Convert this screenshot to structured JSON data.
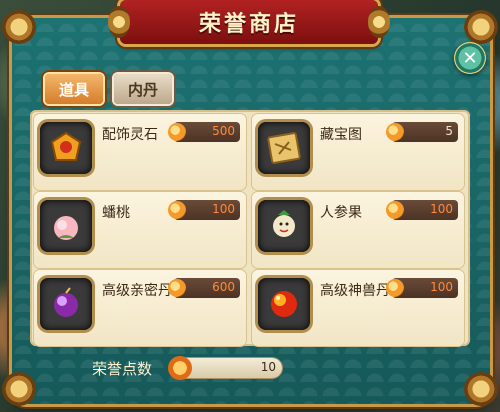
{
  "shop": {
    "title": "荣誉商店",
    "close_icon": "✕",
    "tabs": [
      {
        "label": "道具",
        "active": true
      },
      {
        "label": "内丹",
        "active": false
      }
    ],
    "items": [
      {
        "name": "配饰灵石",
        "price": "500",
        "icon": "gold-gem-icon"
      },
      {
        "name": "藏宝图",
        "price": "5",
        "icon": "treasure-map-icon"
      },
      {
        "name": "蟠桃",
        "price": "100",
        "icon": "peach-icon"
      },
      {
        "name": "人参果",
        "price": "100",
        "icon": "ginseng-fruit-icon"
      },
      {
        "name": "高级亲密丹",
        "price": "600",
        "icon": "purple-pill-icon"
      },
      {
        "name": "高级神兽丹",
        "price": "100",
        "icon": "red-pill-icon"
      }
    ],
    "footer": {
      "label": "荣誉点数",
      "points": "10"
    }
  },
  "colors": {
    "accent": "#d57d2a",
    "panel": "#1f6a6a",
    "title": "#b22222",
    "price": "#ff8a3a"
  }
}
